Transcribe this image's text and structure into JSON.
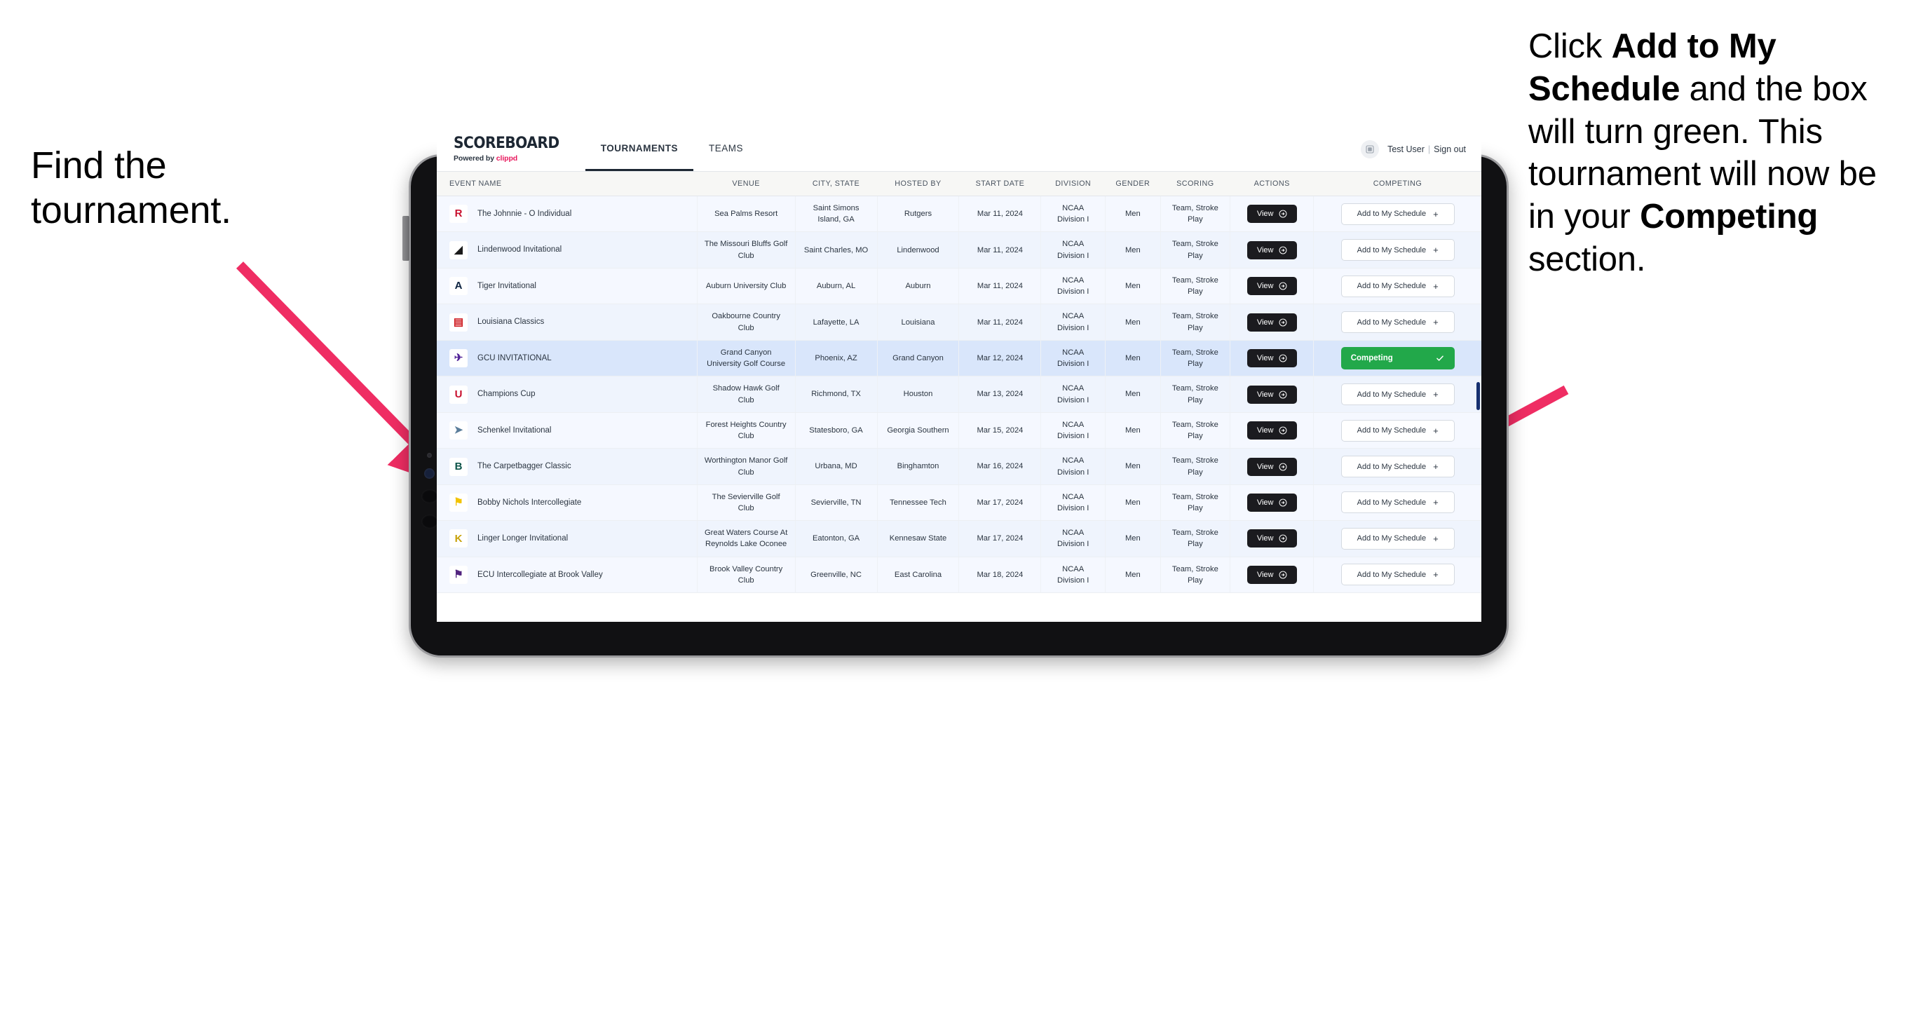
{
  "annotations": {
    "left": "Find the tournament.",
    "right_parts": [
      {
        "text": "Click ",
        "bold": false
      },
      {
        "text": "Add to My Schedule",
        "bold": true
      },
      {
        "text": " and the box will turn green. This tournament will now be in your ",
        "bold": false
      },
      {
        "text": "Competing",
        "bold": true
      },
      {
        "text": " section.",
        "bold": false
      }
    ],
    "arrow_color": "#ef2d63"
  },
  "header": {
    "brand_title": "SCOREBOARD",
    "brand_sub_prefix": "Powered by ",
    "brand_sub_accent": "clippd",
    "tabs": [
      {
        "label": "TOURNAMENTS",
        "active": true
      },
      {
        "label": "TEAMS",
        "active": false
      }
    ],
    "avatar_icon": "user-avatar-icon",
    "user_name": "Test User",
    "separator": "|",
    "sign_out": "Sign out"
  },
  "table": {
    "columns": [
      "EVENT NAME",
      "VENUE",
      "CITY, STATE",
      "HOSTED BY",
      "START DATE",
      "DIVISION",
      "GENDER",
      "SCORING",
      "ACTIONS",
      "COMPETING"
    ],
    "view_label": "View",
    "add_label": "Add to My Schedule",
    "add_icon": "plus-icon",
    "competing_label": "Competing",
    "competing_icon": "check-icon",
    "competing_color": "#22a84a",
    "rows": [
      {
        "logo": "R",
        "logo_bg": "#ffffff",
        "logo_fg": "#c8102e",
        "event": "The Johnnie - O Individual",
        "venue": "Sea Palms Resort",
        "city": "Saint Simons Island, GA",
        "hosted_by": "Rutgers",
        "start_date": "Mar 11, 2024",
        "division": "NCAA Division I",
        "gender": "Men",
        "scoring": "Team, Stroke Play",
        "competing": false
      },
      {
        "logo": "◢",
        "logo_bg": "#ffffff",
        "logo_fg": "#1a1a1a",
        "event": "Lindenwood Invitational",
        "venue": "The Missouri Bluffs Golf Club",
        "city": "Saint Charles, MO",
        "hosted_by": "Lindenwood",
        "start_date": "Mar 11, 2024",
        "division": "NCAA Division I",
        "gender": "Men",
        "scoring": "Team, Stroke Play",
        "competing": false
      },
      {
        "logo": "A",
        "logo_bg": "#ffffff",
        "logo_fg": "#0c2340",
        "event": "Tiger Invitational",
        "venue": "Auburn University Club",
        "city": "Auburn, AL",
        "hosted_by": "Auburn",
        "start_date": "Mar 11, 2024",
        "division": "NCAA Division I",
        "gender": "Men",
        "scoring": "Team, Stroke Play",
        "competing": false
      },
      {
        "logo": "▤",
        "logo_bg": "#ffffff",
        "logo_fg": "#ce181e",
        "event": "Louisiana Classics",
        "venue": "Oakbourne Country Club",
        "city": "Lafayette, LA",
        "hosted_by": "Louisiana",
        "start_date": "Mar 11, 2024",
        "division": "NCAA Division I",
        "gender": "Men",
        "scoring": "Team, Stroke Play",
        "competing": false
      },
      {
        "logo": "✈",
        "logo_bg": "#ffffff",
        "logo_fg": "#522398",
        "event": "GCU INVITATIONAL",
        "venue": "Grand Canyon University Golf Course",
        "city": "Phoenix, AZ",
        "hosted_by": "Grand Canyon",
        "start_date": "Mar 12, 2024",
        "division": "NCAA Division I",
        "gender": "Men",
        "scoring": "Team, Stroke Play",
        "competing": true
      },
      {
        "logo": "U",
        "logo_bg": "#ffffff",
        "logo_fg": "#c8102e",
        "event": "Champions Cup",
        "venue": "Shadow Hawk Golf Club",
        "city": "Richmond, TX",
        "hosted_by": "Houston",
        "start_date": "Mar 13, 2024",
        "division": "NCAA Division I",
        "gender": "Men",
        "scoring": "Team, Stroke Play",
        "competing": false
      },
      {
        "logo": "➤",
        "logo_bg": "#ffffff",
        "logo_fg": "#5a7d9a",
        "event": "Schenkel Invitational",
        "venue": "Forest Heights Country Club",
        "city": "Statesboro, GA",
        "hosted_by": "Georgia Southern",
        "start_date": "Mar 15, 2024",
        "division": "NCAA Division I",
        "gender": "Men",
        "scoring": "Team, Stroke Play",
        "competing": false
      },
      {
        "logo": "B",
        "logo_bg": "#ffffff",
        "logo_fg": "#0c5449",
        "event": "The Carpetbagger Classic",
        "venue": "Worthington Manor Golf Club",
        "city": "Urbana, MD",
        "hosted_by": "Binghamton",
        "start_date": "Mar 16, 2024",
        "division": "NCAA Division I",
        "gender": "Men",
        "scoring": "Team, Stroke Play",
        "competing": false
      },
      {
        "logo": "⚑",
        "logo_bg": "#ffffff",
        "logo_fg": "#f2c300",
        "event": "Bobby Nichols Intercollegiate",
        "venue": "The Sevierville Golf Club",
        "city": "Sevierville, TN",
        "hosted_by": "Tennessee Tech",
        "start_date": "Mar 17, 2024",
        "division": "NCAA Division I",
        "gender": "Men",
        "scoring": "Team, Stroke Play",
        "competing": false
      },
      {
        "logo": "K",
        "logo_bg": "#ffffff",
        "logo_fg": "#c8a20a",
        "event": "Linger Longer Invitational",
        "venue": "Great Waters Course At Reynolds Lake Oconee",
        "city": "Eatonton, GA",
        "hosted_by": "Kennesaw State",
        "start_date": "Mar 17, 2024",
        "division": "NCAA Division I",
        "gender": "Men",
        "scoring": "Team, Stroke Play",
        "competing": false
      },
      {
        "logo": "⚑",
        "logo_bg": "#ffffff",
        "logo_fg": "#52247f",
        "event": "ECU Intercollegiate at Brook Valley",
        "venue": "Brook Valley Country Club",
        "city": "Greenville, NC",
        "hosted_by": "East Carolina",
        "start_date": "Mar 18, 2024",
        "division": "NCAA Division I",
        "gender": "Men",
        "scoring": "Team, Stroke Play",
        "competing": false
      }
    ]
  }
}
